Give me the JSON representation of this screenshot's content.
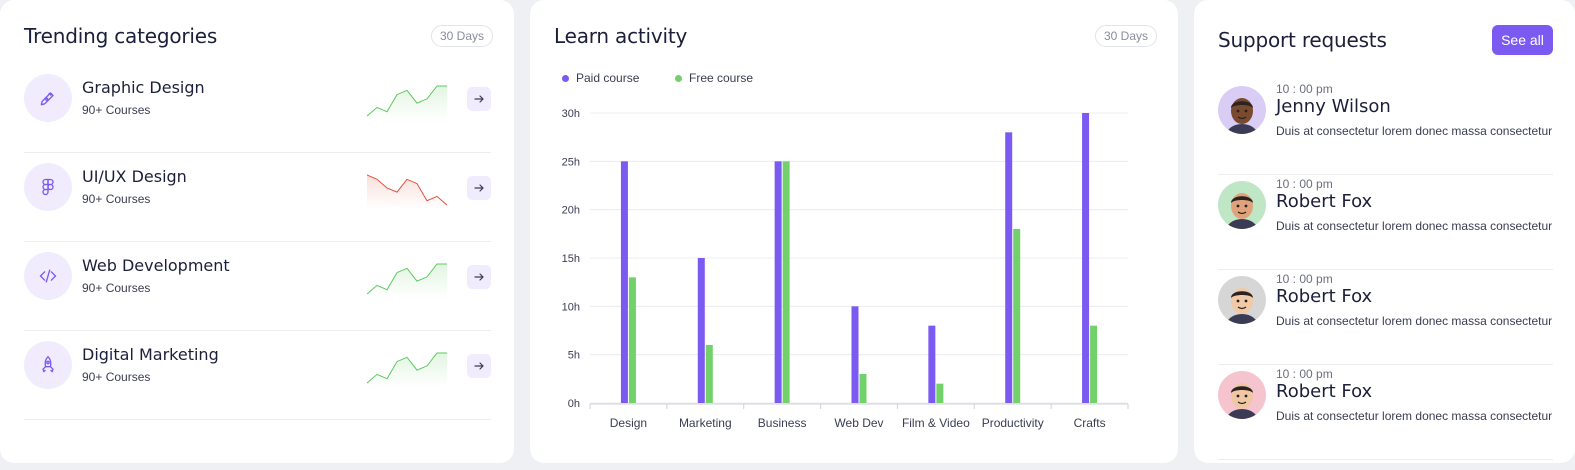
{
  "trending": {
    "title": "Trending categories",
    "period": "30 Days",
    "items": [
      {
        "name": "Graphic Design",
        "sub": "90+ Courses",
        "icon": "pen-tool-icon",
        "trend": "up",
        "spark": [
          2,
          4,
          3,
          7,
          8,
          5,
          6,
          9,
          9
        ]
      },
      {
        "name": "UI/UX Design",
        "sub": "90+ Courses",
        "icon": "figma-icon",
        "trend": "down",
        "spark": [
          9,
          8,
          6,
          5,
          8,
          7,
          3,
          4,
          2
        ]
      },
      {
        "name": "Web Development",
        "sub": "90+ Courses",
        "icon": "code-icon",
        "trend": "up",
        "spark": [
          2,
          4,
          3,
          7,
          8,
          5,
          6,
          9,
          9
        ]
      },
      {
        "name": "Digital Marketing",
        "sub": "90+ Courses",
        "icon": "rocket-icon",
        "trend": "up",
        "spark": [
          2,
          4,
          3,
          7,
          8,
          5,
          6,
          9,
          9
        ]
      }
    ],
    "colors": {
      "up": "#5cc95c",
      "down": "#e0513d",
      "accent": "#7a5af0"
    }
  },
  "activity": {
    "title": "Learn activity",
    "period": "30 Days"
  },
  "chart_data": {
    "type": "bar",
    "categories": [
      "Design",
      "Marketing",
      "Business",
      "Web Dev",
      "Film & Video",
      "Productivity",
      "Crafts"
    ],
    "series": [
      {
        "name": "Paid course",
        "color": "#7a5af0",
        "values": [
          25,
          15,
          25,
          10,
          8,
          28,
          30
        ]
      },
      {
        "name": "Free course",
        "color": "#72d16a",
        "values": [
          13,
          6,
          25,
          3,
          2,
          18,
          8
        ]
      }
    ],
    "yticks": [
      "0h",
      "5h",
      "10h",
      "15h",
      "20h",
      "25h",
      "30h"
    ],
    "ylim": [
      0,
      30
    ],
    "grid": true,
    "legend": "top-left"
  },
  "support": {
    "title": "Support requests",
    "see_all": "See all",
    "items": [
      {
        "time": "10 : 00 pm",
        "name": "Jenny Wilson",
        "msg": "Duis at consectetur lorem donec massa consectetur",
        "bg": "#d9cdf5",
        "skin": "#7a4a2e"
      },
      {
        "time": "10 : 00 pm",
        "name": "Robert Fox",
        "msg": "Duis at consectetur lorem donec massa consectetur",
        "bg": "#bfe7c6",
        "skin": "#e0a27b"
      },
      {
        "time": "10 : 00 pm",
        "name": "Robert Fox",
        "msg": "Duis at consectetur lorem donec massa consectetur",
        "bg": "#d6d6d6",
        "skin": "#f1c9a6"
      },
      {
        "time": "10 : 00 pm",
        "name": "Robert Fox",
        "msg": "Duis at consectetur lorem donec massa consectetur",
        "bg": "#f5c4cf",
        "skin": "#f0c6a4"
      }
    ]
  }
}
